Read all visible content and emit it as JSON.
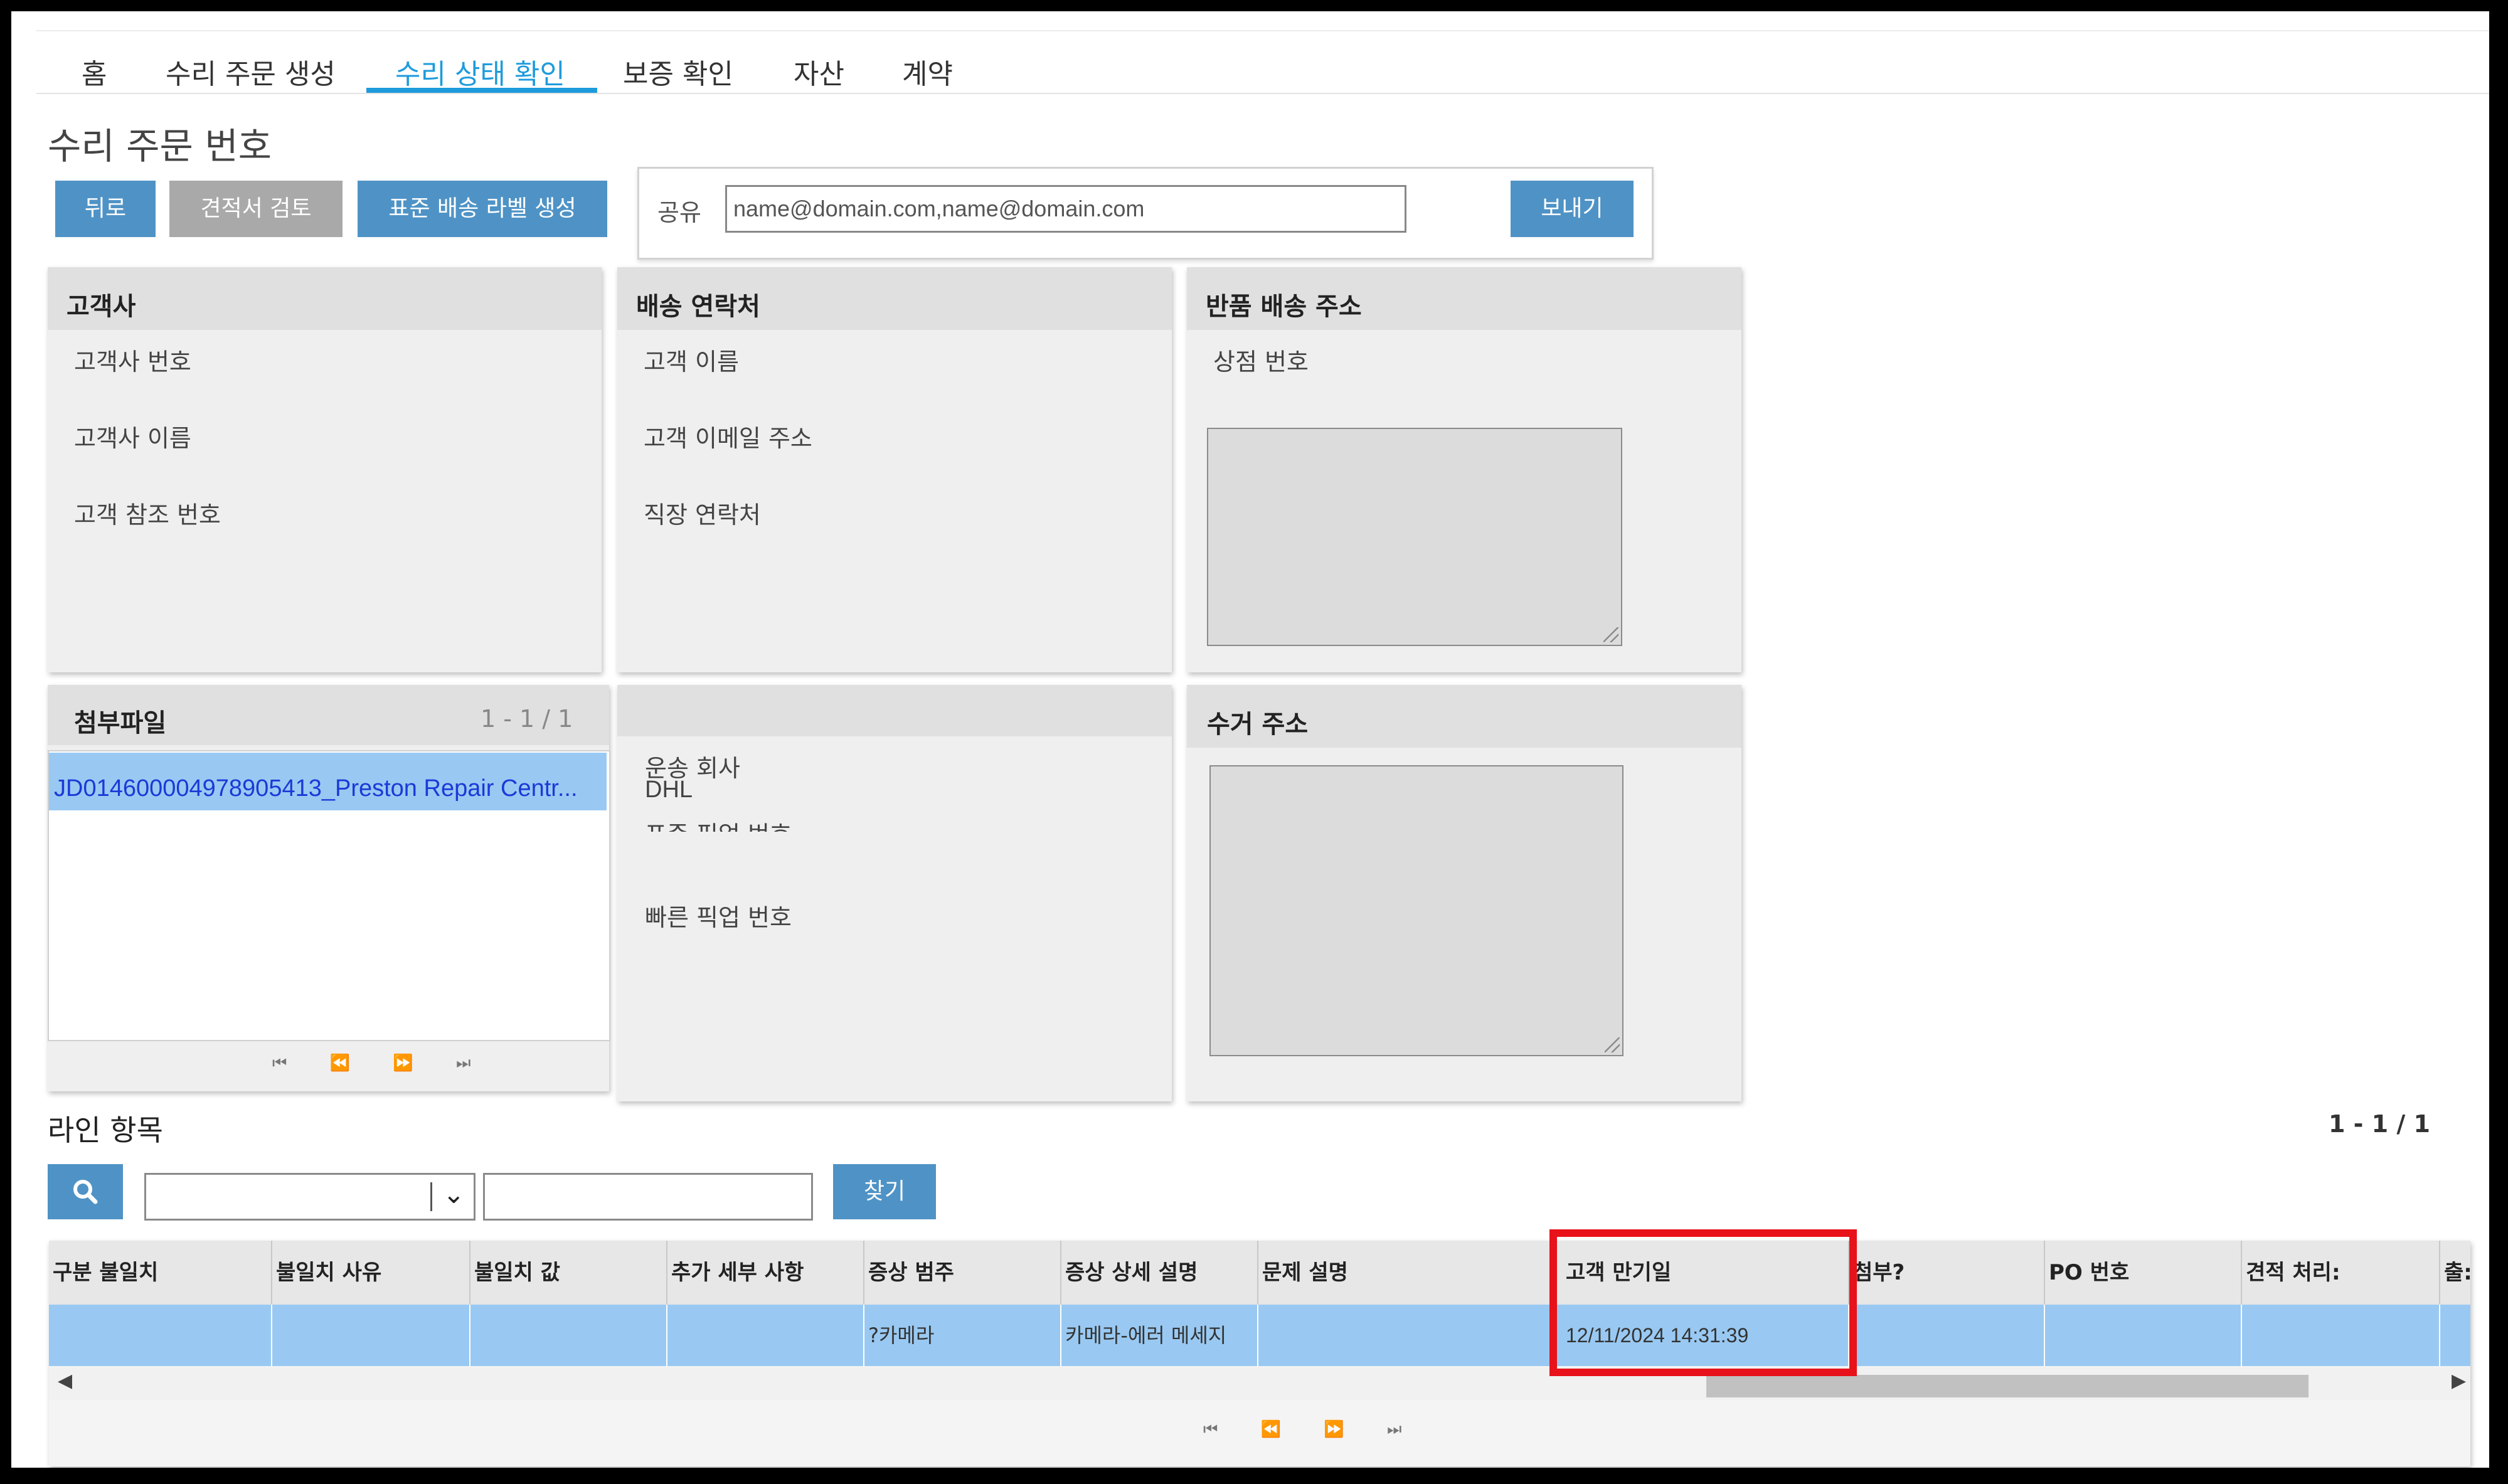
{
  "nav": {
    "tabs": [
      {
        "label": "홈"
      },
      {
        "label": "수리 주문 생성"
      },
      {
        "label": "수리 상태 확인"
      },
      {
        "label": "보증 확인"
      },
      {
        "label": "자산"
      },
      {
        "label": "계약"
      }
    ],
    "active_tab": "수리 상태 확인"
  },
  "page_title": "수리 주문 번호",
  "toolbar": {
    "back": "뒤로",
    "review_quote": "견적서 검토",
    "create_label": "표준 배송 라벨 생성"
  },
  "share": {
    "label": "공유",
    "placeholder": "name@domain.com,name@domain.com",
    "send": "보내기"
  },
  "customer_panel": {
    "title": "고객사",
    "fields": [
      "고객사 번호",
      "고객사 이름",
      "고객 참조 번호"
    ]
  },
  "shipping_contact_panel": {
    "title": "배송 연락처",
    "fields": [
      "고객 이름",
      "고객 이메일 주소",
      "직장 연락처"
    ]
  },
  "return_address_panel": {
    "title": "반품 배송 주소",
    "fields": [
      "상점 번호"
    ]
  },
  "attachments_panel": {
    "title": "첨부파일",
    "count": "1 - 1 / 1",
    "items": [
      "JD014600004978905413_Preston Repair Centr..."
    ],
    "pager": "⏮ ⏪ ⏩ ⏭"
  },
  "shipping_panel": {
    "carrier_label": "운송 회사",
    "carrier_value": "DHL",
    "standard_pickup": "표준 픽업 번호",
    "quick_pickup": "빠른 픽업 번호"
  },
  "pickup_address_panel": {
    "title": "수거 주소"
  },
  "line_items": {
    "title": "라인 항목",
    "count": "1 - 1 / 1",
    "find": "찾기",
    "columns": [
      "구분 불일치",
      "불일치 사유",
      "불일치 값",
      "추가 세부 사항",
      "증상 범주",
      "증상 상세 설명",
      "문제 설명",
      "고객 만기일",
      "첨부?",
      "PO 번호",
      "견적 처리:",
      "출:"
    ],
    "rows": [
      [
        "",
        "",
        "",
        "",
        "?카메라",
        "카메라-에러 메세지",
        "",
        "12/11/2024 14:31:39",
        "",
        "",
        "",
        ""
      ]
    ],
    "pager": "⏮ ⏪ ⏩ ⏭"
  },
  "colors": {
    "accent": "#1e9bdc",
    "button": "#4f93c6",
    "selected_row": "#99c9f2",
    "highlight": "#e8121a"
  }
}
